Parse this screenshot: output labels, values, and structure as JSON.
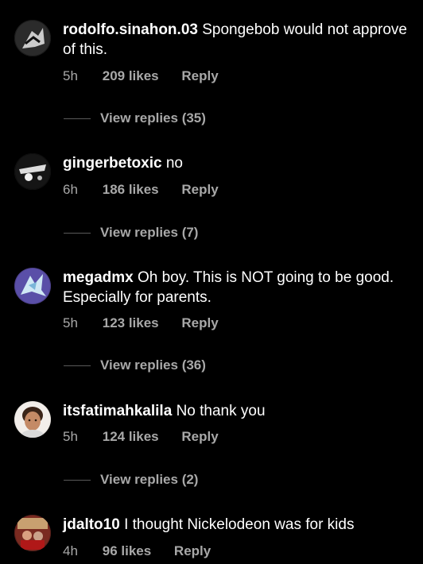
{
  "comments": [
    {
      "username": "rodolfo.sinahon.03",
      "text": "Spongebob would not approve of this.",
      "time": "5h",
      "likes": "209 likes",
      "reply": "Reply",
      "view_replies": "View replies (35)"
    },
    {
      "username": "gingerbetoxic",
      "text": "no",
      "time": "6h",
      "likes": "186 likes",
      "reply": "Reply",
      "view_replies": "View replies (7)"
    },
    {
      "username": "megadmx",
      "text": "Oh boy. This is NOT going to be good. Especially for parents.",
      "time": "5h",
      "likes": "123 likes",
      "reply": "Reply",
      "view_replies": "View replies (36)"
    },
    {
      "username": "itsfatimahkalila",
      "text": "No thank you",
      "time": "5h",
      "likes": "124 likes",
      "reply": "Reply",
      "view_replies": "View replies (2)"
    },
    {
      "username": "jdalto10",
      "text": "I thought Nickelodeon was for kids",
      "time": "4h",
      "likes": "96 likes",
      "reply": "Reply"
    }
  ],
  "colors": {
    "background": "#000000",
    "primary_text": "#ffffff",
    "secondary_text": "#a8a8a8"
  }
}
